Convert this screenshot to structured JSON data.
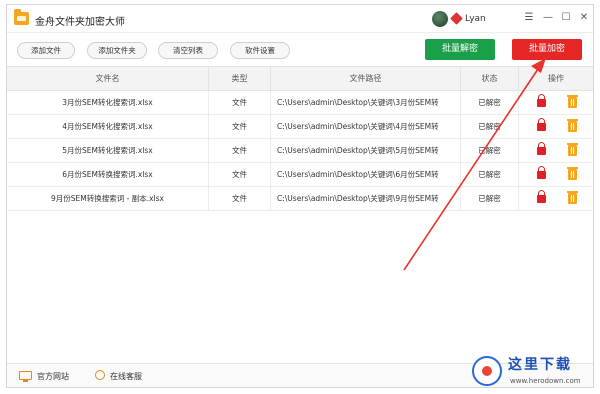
{
  "app": {
    "title": "金舟文件夹加密大师",
    "username": "Lyan"
  },
  "toolbar": {
    "add_file": "添加文件",
    "add_folder": "添加文件夹",
    "clear_list": "清空列表",
    "settings": "软件设置",
    "batch_decrypt": "批量解密",
    "batch_encrypt": "批量加密"
  },
  "table": {
    "headers": {
      "name": "文件名",
      "type": "类型",
      "path": "文件路径",
      "status": "状态",
      "ops": "操作"
    },
    "rows": [
      {
        "name": "3月份SEM转化搜索词.xlsx",
        "type": "文件",
        "path": "C:\\Users\\admin\\Desktop\\关键词\\3月份SEM转",
        "status": "已解密"
      },
      {
        "name": "4月份SEM转化搜索词.xlsx",
        "type": "文件",
        "path": "C:\\Users\\admin\\Desktop\\关键词\\4月份SEM转",
        "status": "已解密"
      },
      {
        "name": "5月份SEM转化搜索词.xlsx",
        "type": "文件",
        "path": "C:\\Users\\admin\\Desktop\\关键词\\5月份SEM转",
        "status": "已解密"
      },
      {
        "name": "6月份SEM转换搜索词.xlsx",
        "type": "文件",
        "path": "C:\\Users\\admin\\Desktop\\关键词\\6月份SEM转",
        "status": "已解密"
      },
      {
        "name": "9月份SEM转换搜索词 - 副本.xlsx",
        "type": "文件",
        "path": "C:\\Users\\admin\\Desktop\\关键词\\9月份SEM转",
        "status": "已解密"
      }
    ]
  },
  "footer": {
    "official_site": "官方网站",
    "online_support": "在线客服"
  },
  "watermark": {
    "title": "这里下载",
    "url": "www.herodown.com"
  },
  "colors": {
    "decrypt_green": "#1aa04a",
    "encrypt_red": "#e62525",
    "lock_red": "#e02020",
    "trash_orange": "#f5a623",
    "arrow_red": "#e8322b"
  },
  "icons": [
    "app-folder-icon",
    "avatar",
    "vip-diamond-icon",
    "menu-icon",
    "minimize-icon",
    "maximize-icon",
    "close-icon",
    "lock-icon",
    "trash-icon",
    "monitor-icon",
    "support-icon"
  ]
}
